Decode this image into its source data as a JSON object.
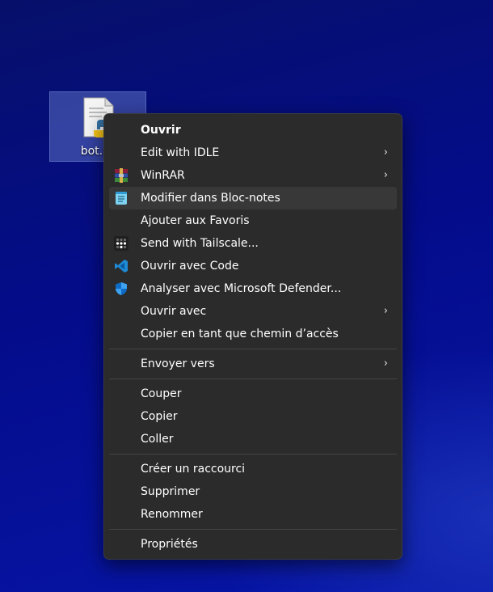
{
  "desktop": {
    "file_label": "bot.py",
    "file_icon": "python-file-icon"
  },
  "menu": {
    "items": [
      {
        "label": "Ouvrir",
        "bold": true
      },
      {
        "label": "Edit with IDLE",
        "submenu": true
      },
      {
        "label": "WinRAR",
        "icon": "winrar-icon",
        "submenu": true
      },
      {
        "label": "Modifier dans Bloc-notes",
        "icon": "notepad-icon",
        "highlighted": true
      },
      {
        "label": "Ajouter aux Favoris"
      },
      {
        "label": "Send with Tailscale...",
        "icon": "tailscale-icon"
      },
      {
        "label": "Ouvrir avec Code",
        "icon": "vscode-icon"
      },
      {
        "label": "Analyser avec Microsoft Defender...",
        "icon": "defender-shield-icon"
      },
      {
        "label": "Ouvrir avec",
        "submenu": true
      },
      {
        "label": "Copier en tant que chemin d’accès"
      },
      {
        "label": "Envoyer vers",
        "submenu": true
      },
      {
        "label": "Couper"
      },
      {
        "label": "Copier"
      },
      {
        "label": "Coller"
      },
      {
        "label": "Créer un raccourci"
      },
      {
        "label": "Supprimer"
      },
      {
        "label": "Renommer"
      },
      {
        "label": "Propriétés"
      }
    ],
    "chevron": "›"
  },
  "colors": {
    "menu_bg": "#2b2b2b",
    "menu_hover": "#383838",
    "desktop_bg": "#040c8a",
    "vscode_blue": "#1f8ad6",
    "defender_blue": "#0f6cc4"
  }
}
